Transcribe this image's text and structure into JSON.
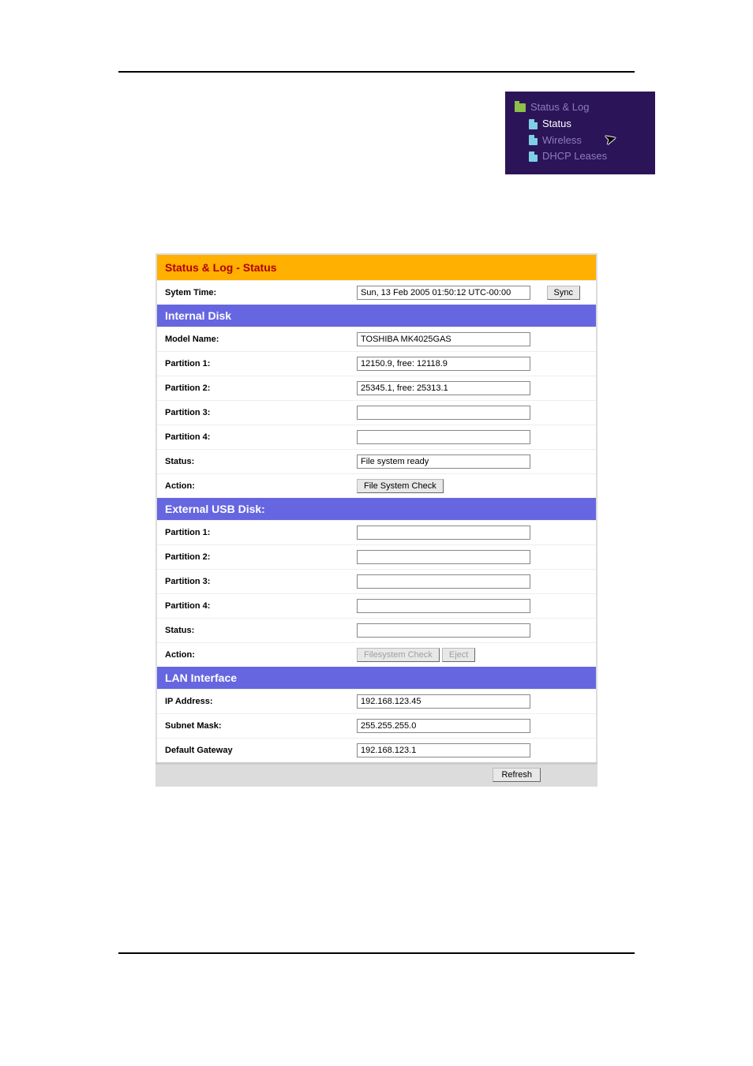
{
  "nav": {
    "root": "Status & Log",
    "items": [
      {
        "label": "Status"
      },
      {
        "label": "Wireless"
      },
      {
        "label": "DHCP Leases"
      }
    ]
  },
  "panel": {
    "title": "Status & Log - Status",
    "system_time_label": "Sytem Time:",
    "system_time_value": "Sun, 13 Feb 2005 01:50:12 UTC-00:00",
    "sync_label": "Sync",
    "internal": {
      "header": "Internal Disk",
      "model_label": "Model Name:",
      "model_value": "TOSHIBA MK4025GAS",
      "p1_label": "Partition 1:",
      "p1_value": "12150.9, free: 12118.9",
      "p2_label": "Partition 2:",
      "p2_value": "25345.1, free: 25313.1",
      "p3_label": "Partition 3:",
      "p3_value": "",
      "p4_label": "Partition 4:",
      "p4_value": "",
      "status_label": "Status:",
      "status_value": "File system ready",
      "action_label": "Action:",
      "fsck_label": "File System Check"
    },
    "external": {
      "header": "External USB Disk:",
      "p1_label": "Partition 1:",
      "p1_value": "",
      "p2_label": "Partition 2:",
      "p2_value": "",
      "p3_label": "Partition 3:",
      "p3_value": "",
      "p4_label": "Partition 4:",
      "p4_value": "",
      "status_label": "Status:",
      "status_value": "",
      "action_label": "Action:",
      "fsck_label": "Filesystem Check",
      "eject_label": "Eject"
    },
    "lan": {
      "header": "LAN Interface",
      "ip_label": "IP Address:",
      "ip_value": "192.168.123.45",
      "mask_label": "Subnet Mask:",
      "mask_value": "255.255.255.0",
      "gw_label": "Default Gateway",
      "gw_value": "192.168.123.1"
    },
    "refresh_label": "Refresh"
  }
}
